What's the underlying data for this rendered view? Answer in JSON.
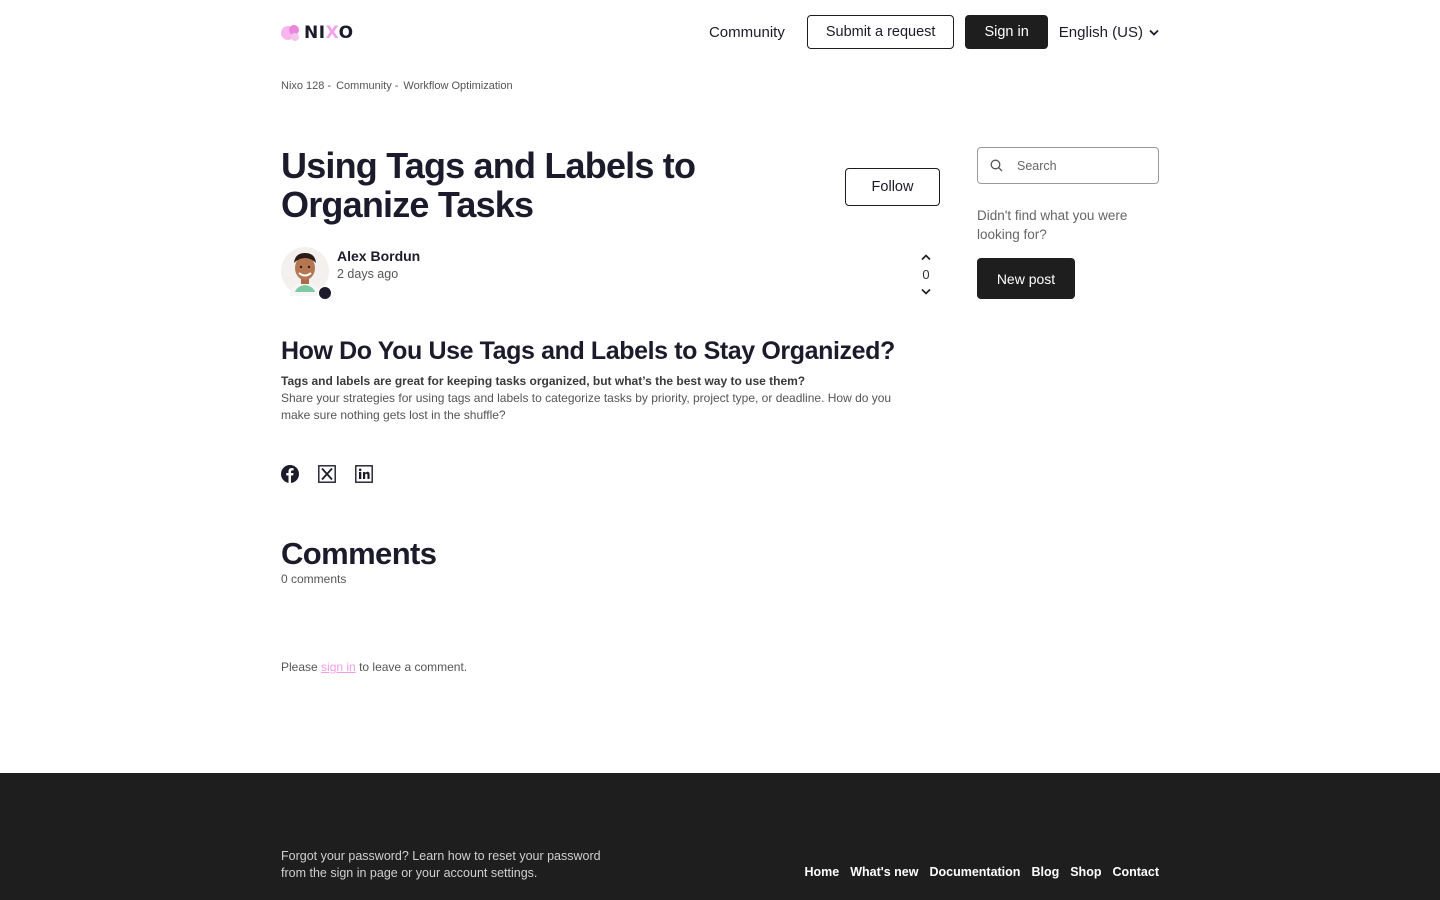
{
  "header": {
    "logo_text_1": "NI",
    "logo_text_x": "X",
    "logo_text_2": "O",
    "nav": {
      "community": "Community",
      "submit_request": "Submit a request",
      "sign_in": "Sign in",
      "language": "English (US)"
    }
  },
  "breadcrumb": [
    "Nixo 128",
    "Community",
    "Workflow Optimization"
  ],
  "breadcrumb_separator": "-",
  "post": {
    "title": "Using Tags and Labels to Organize Tasks",
    "follow_label": "Follow",
    "author_name": "Alex Bordun",
    "author_time": "2 days ago",
    "vote_count": "0",
    "heading": "How Do You Use Tags and Labels to Stay Organized?",
    "lead": "Tags and labels are great for keeping tasks organized, but what’s the best way to use them?",
    "body": "Share your strategies for using tags and labels to categorize tasks by priority, project type, or deadline. How do you make sure nothing gets lost in the shuffle?"
  },
  "share_icons": [
    "facebook-icon",
    "x-twitter-icon",
    "linkedin-icon"
  ],
  "comments": {
    "title": "Comments",
    "count": "0 comments",
    "note_prefix": "Please",
    "note_link": "sign in",
    "note_suffix": "to leave a comment."
  },
  "sidebar": {
    "search_placeholder": "Search",
    "help_text": "Didn't find what you were looking for?",
    "new_post_label": "New post"
  },
  "footer": {
    "text": "Forgot your password? Learn how to reset your password from the sign in page or your account settings.",
    "links": [
      "Home",
      "What's new",
      "Documentation",
      "Blog",
      "Shop",
      "Contact"
    ]
  },
  "colors": {
    "accent": "#f29be7",
    "dark": "#1e1e1e",
    "text": "#1b1b2b"
  }
}
